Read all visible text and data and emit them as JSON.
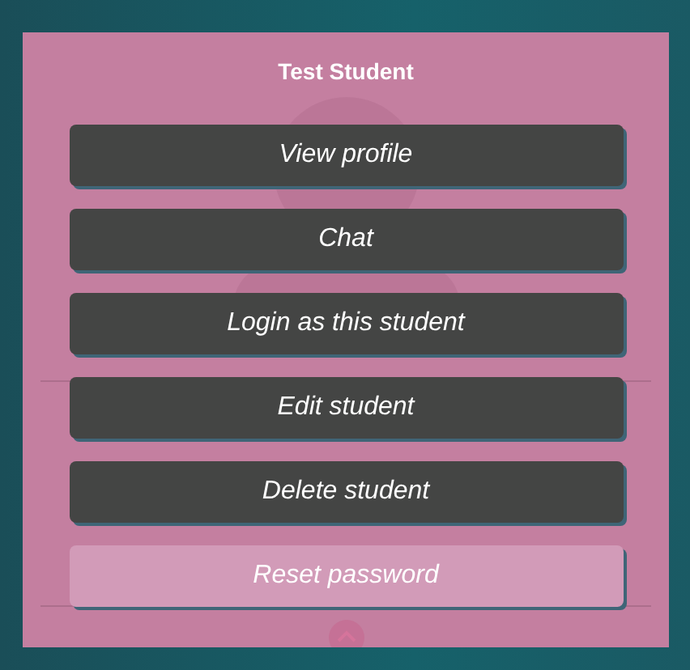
{
  "dialog": {
    "title": "Test Student",
    "actions": [
      {
        "label": "View profile",
        "kind": "dark"
      },
      {
        "label": "Chat",
        "kind": "dark"
      },
      {
        "label": "Login as this student",
        "kind": "dark"
      },
      {
        "label": "Edit student",
        "kind": "dark"
      },
      {
        "label": "Delete student",
        "kind": "dark"
      },
      {
        "label": "Reset password",
        "kind": "light"
      }
    ]
  }
}
